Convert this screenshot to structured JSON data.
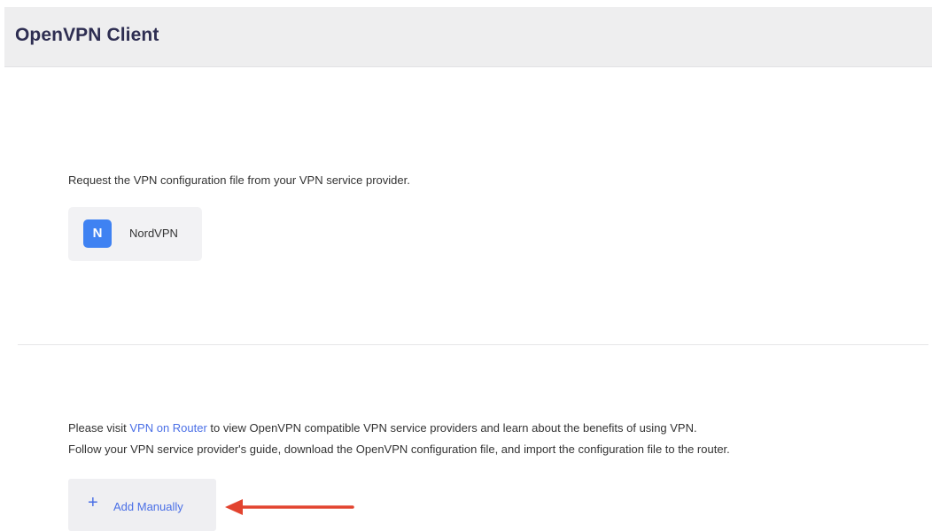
{
  "header": {
    "title": "OpenVPN Client"
  },
  "providers": {
    "intro": "Request the VPN configuration file from your VPN service provider.",
    "items": [
      {
        "logo_letter": "N",
        "name": "NordVPN",
        "logo_color": "#3f82f2"
      }
    ]
  },
  "manual": {
    "line1_prefix": "Please visit ",
    "line1_link": "VPN on Router",
    "line1_suffix": " to view OpenVPN compatible VPN service providers and learn about the benefits of using VPN.",
    "line2": "Follow your VPN service provider's guide, download the OpenVPN configuration file, and import the configuration file to the router.",
    "add_button_icon": "+",
    "add_button_label": "Add Manually"
  },
  "colors": {
    "accent": "#4a6fe6",
    "annotation_arrow": "#e2432f",
    "header_bg": "#eeeeef"
  }
}
